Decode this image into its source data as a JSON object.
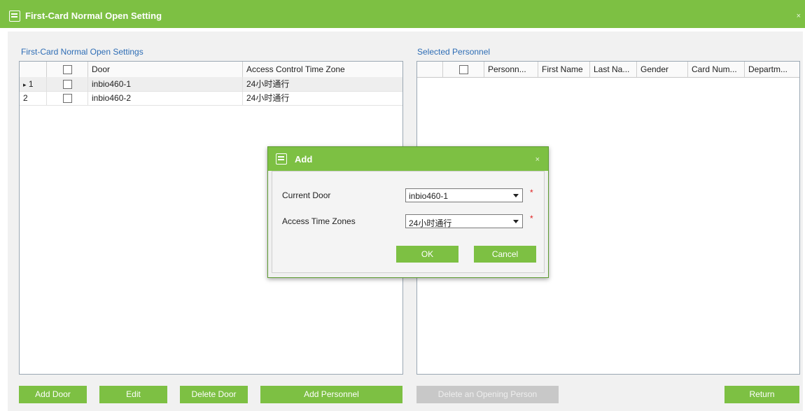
{
  "window": {
    "title": "First-Card Normal Open Setting",
    "close_glyph": "×"
  },
  "left_panel": {
    "title": "First-Card Normal Open Settings",
    "columns": [
      "",
      "",
      "Door",
      "Access Control Time Zone"
    ],
    "rows": [
      {
        "marker": "▸",
        "index": "1",
        "door": "inbio460-1",
        "time_zone": "24小时通行"
      },
      {
        "marker": "",
        "index": "2",
        "door": "inbio460-2",
        "time_zone": "24小时通行"
      }
    ]
  },
  "right_panel": {
    "title": "Selected Personnel",
    "columns": [
      "Personn...",
      "First Name",
      "Last Na...",
      "Gender",
      "Card Num...",
      "Departm..."
    ]
  },
  "dialog": {
    "title": "Add",
    "close_glyph": "×",
    "current_door_label": "Current Door",
    "current_door_value": "inbio460-1",
    "time_zones_label": "Access Time Zones",
    "time_zones_value": "24小时通行",
    "required_mark": "*",
    "ok_label": "OK",
    "cancel_label": "Cancel"
  },
  "buttons": {
    "add_door": "Add Door",
    "edit": "Edit",
    "delete_door": "Delete Door",
    "add_personnel": "Add Personnel",
    "delete_opening_person": "Delete an Opening Person",
    "return": "Return"
  },
  "colors": {
    "accent": "#7dc043",
    "section_title": "#2e6db5",
    "disabled": "#c8c8c8",
    "required": "#e02020"
  }
}
